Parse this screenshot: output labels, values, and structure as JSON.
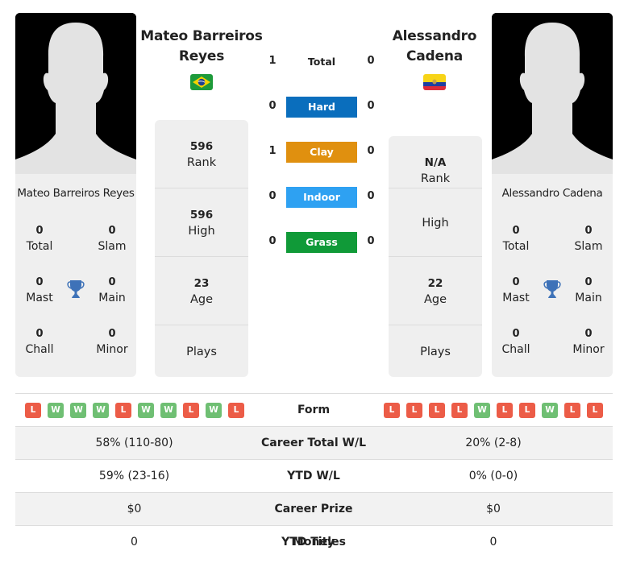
{
  "colors": {
    "hard": "#0a6ebd",
    "clay": "#e0900f",
    "indoor": "#2ea1f2",
    "grass": "#109a38",
    "win": "#6fbf73",
    "loss": "#ec5c47",
    "trophy": "#3e72b8"
  },
  "player1": {
    "title_line1": "Mateo Barreiros",
    "title_line2": "Reyes",
    "card_name": "Mateo Barreiros Reyes",
    "flag": "brazil-flag",
    "titles": {
      "total": {
        "value": "0",
        "label": "Total"
      },
      "slam": {
        "value": "0",
        "label": "Slam"
      },
      "mast": {
        "value": "0",
        "label": "Mast"
      },
      "main": {
        "value": "0",
        "label": "Main"
      },
      "chall": {
        "value": "0",
        "label": "Chall"
      },
      "minor": {
        "value": "0",
        "label": "Minor"
      }
    },
    "stats": {
      "rank": {
        "value": "596",
        "label": "Rank"
      },
      "high": {
        "value": "596",
        "label": "High"
      },
      "age": {
        "value": "23",
        "label": "Age"
      },
      "plays": {
        "value": "",
        "label": "Plays"
      }
    },
    "form": [
      "L",
      "W",
      "W",
      "W",
      "L",
      "W",
      "W",
      "L",
      "W",
      "L"
    ]
  },
  "player2": {
    "title_line1": "Alessandro",
    "title_line2": "Cadena",
    "card_name": "Alessandro Cadena",
    "flag": "ecuador-flag",
    "titles": {
      "total": {
        "value": "0",
        "label": "Total"
      },
      "slam": {
        "value": "0",
        "label": "Slam"
      },
      "mast": {
        "value": "0",
        "label": "Mast"
      },
      "main": {
        "value": "0",
        "label": "Main"
      },
      "chall": {
        "value": "0",
        "label": "Chall"
      },
      "minor": {
        "value": "0",
        "label": "Minor"
      }
    },
    "stats": {
      "rank": {
        "value": "N/A",
        "label": "Rank"
      },
      "high": {
        "value": "",
        "label": "High"
      },
      "age": {
        "value": "22",
        "label": "Age"
      },
      "plays": {
        "value": "",
        "label": "Plays"
      }
    },
    "form": [
      "L",
      "L",
      "L",
      "L",
      "W",
      "L",
      "L",
      "W",
      "L",
      "L"
    ]
  },
  "h2h": [
    {
      "label": "Total",
      "p1": "1",
      "p2": "0",
      "surface": "total"
    },
    {
      "label": "Hard",
      "p1": "0",
      "p2": "0",
      "surface": "hard"
    },
    {
      "label": "Clay",
      "p1": "1",
      "p2": "0",
      "surface": "clay"
    },
    {
      "label": "Indoor",
      "p1": "0",
      "p2": "0",
      "surface": "indoor"
    },
    {
      "label": "Grass",
      "p1": "0",
      "p2": "0",
      "surface": "grass"
    }
  ],
  "table": {
    "form_label": "Form",
    "rows": [
      {
        "label": "Career Total W/L",
        "p1": "58% (110-80)",
        "p2": "20% (2-8)"
      },
      {
        "label": "YTD W/L",
        "p1": "59% (23-16)",
        "p2": "0% (0-0)"
      },
      {
        "label": "Career Prize Money",
        "p1": "$0",
        "p2": "$0"
      },
      {
        "label": "YTD Titles",
        "p1": "0",
        "p2": "0"
      }
    ]
  }
}
